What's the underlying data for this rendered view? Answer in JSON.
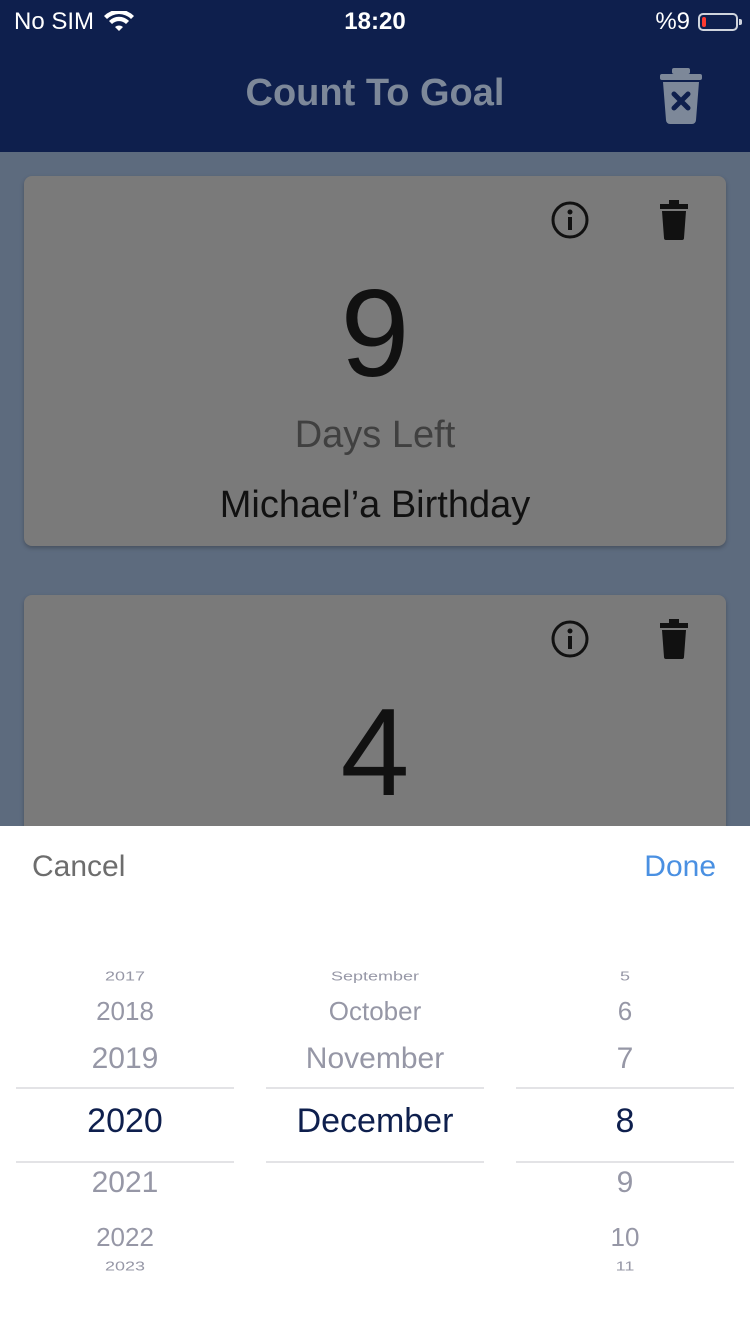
{
  "status_bar": {
    "carrier": "No SIM",
    "time": "18:20",
    "battery_text": "%9",
    "battery_level": 0.09,
    "icons": [
      "wifi-icon",
      "battery-icon"
    ]
  },
  "navbar": {
    "title": "Count To Goal",
    "action_icon": "trash-delete-all-icon"
  },
  "cards": [
    {
      "count": "9",
      "label": "Days Left",
      "name": "Michael’a Birthday",
      "icons": [
        "info-icon",
        "trash-icon"
      ]
    },
    {
      "count": "4",
      "icons": [
        "info-icon",
        "trash-icon"
      ]
    }
  ],
  "picker": {
    "cancel": "Cancel",
    "done": "Done",
    "years": {
      "far_above": "2017",
      "above2": "2018",
      "above1": "2019",
      "selected": "2020",
      "below1": "2021",
      "below2": "2022",
      "far_below": "2023"
    },
    "months": {
      "far_above": "September",
      "above2": "October",
      "above1": "November",
      "selected": "December"
    },
    "days": {
      "far_above": "5",
      "above2": "6",
      "above1": "7",
      "selected": "8",
      "below1": "9",
      "below2": "10",
      "far_below": "11"
    }
  },
  "colors": {
    "navbar": "#0e1f4d",
    "overlay_bg": "#5d6b7e",
    "card": "#7a7a7a",
    "accent": "#4a90e2",
    "picker_selected": "#0e1f4d"
  }
}
